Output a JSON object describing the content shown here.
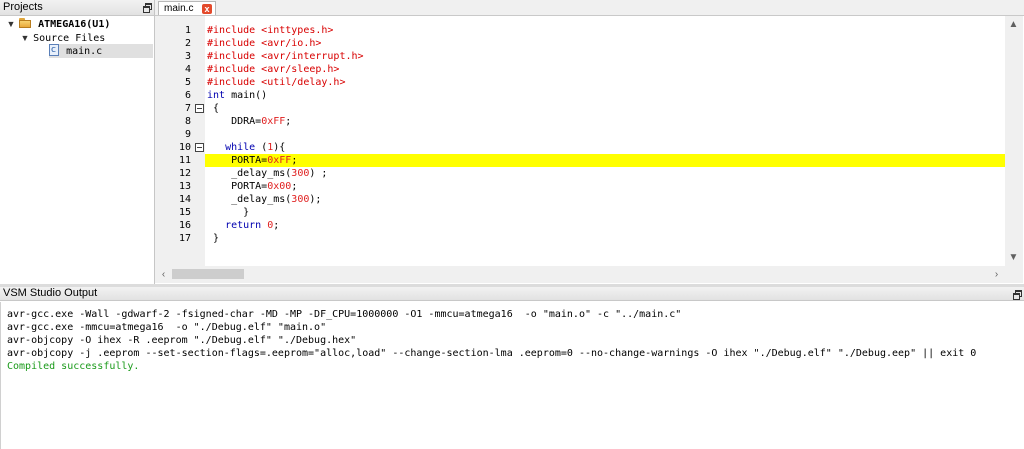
{
  "projects": {
    "title": "Projects",
    "project_name": "ATMEGA16(U1)",
    "source_files_label": "Source Files",
    "file_name": "main.c"
  },
  "editor": {
    "tab_label": "main.c",
    "close_glyph": "x",
    "line_numbers": [
      "1",
      "2",
      "3",
      "4",
      "5",
      "6",
      "7",
      "8",
      "9",
      "10",
      "11",
      "12",
      "13",
      "14",
      "15",
      "16",
      "17"
    ],
    "lines": [
      [
        {
          "t": "#include <inttypes.h>",
          "c": "pp"
        }
      ],
      [
        {
          "t": "#include <avr/io.h>",
          "c": "pp"
        }
      ],
      [
        {
          "t": "#include <avr/interrupt.h>",
          "c": "pp"
        }
      ],
      [
        {
          "t": "#include <avr/sleep.h>",
          "c": "pp"
        }
      ],
      [
        {
          "t": "#include <util/delay.h>",
          "c": "pp"
        }
      ],
      [
        {
          "t": "int",
          "c": "kw"
        },
        {
          "t": " main()",
          "c": "plain"
        }
      ],
      [
        {
          "t": " {",
          "c": "plain"
        }
      ],
      [
        {
          "t": "    DDRA=",
          "c": "plain"
        },
        {
          "t": "0xFF",
          "c": "num"
        },
        {
          "t": ";",
          "c": "plain"
        }
      ],
      [
        {
          "t": "",
          "c": "plain"
        }
      ],
      [
        {
          "t": "   ",
          "c": "plain"
        },
        {
          "t": "while",
          "c": "kw"
        },
        {
          "t": " (",
          "c": "plain"
        },
        {
          "t": "1",
          "c": "num"
        },
        {
          "t": "){",
          "c": "plain"
        }
      ],
      [
        {
          "t": "    PORTA=",
          "c": "plain"
        },
        {
          "t": "0xFF",
          "c": "num"
        },
        {
          "t": ";",
          "c": "plain"
        }
      ],
      [
        {
          "t": "    _delay_ms(",
          "c": "plain"
        },
        {
          "t": "300",
          "c": "num"
        },
        {
          "t": ") ;",
          "c": "plain"
        }
      ],
      [
        {
          "t": "    PORTA=",
          "c": "plain"
        },
        {
          "t": "0x00",
          "c": "num"
        },
        {
          "t": ";",
          "c": "plain"
        }
      ],
      [
        {
          "t": "    _delay_ms(",
          "c": "plain"
        },
        {
          "t": "300",
          "c": "num"
        },
        {
          "t": ");",
          "c": "plain"
        }
      ],
      [
        {
          "t": "      }",
          "c": "plain"
        }
      ],
      [
        {
          "t": "   ",
          "c": "plain"
        },
        {
          "t": "return",
          "c": "kw"
        },
        {
          "t": " ",
          "c": "plain"
        },
        {
          "t": "0",
          "c": "num"
        },
        {
          "t": ";",
          "c": "plain"
        }
      ],
      [
        {
          "t": " }",
          "c": "plain"
        }
      ]
    ],
    "highlighted_line": 11,
    "fold_lines": [
      7,
      10
    ]
  },
  "output": {
    "title": "VSM Studio Output",
    "lines": [
      "avr-gcc.exe -Wall -gdwarf-2 -fsigned-char -MD -MP -DF_CPU=1000000 -O1 -mmcu=atmega16  -o \"main.o\" -c \"../main.c\"",
      "avr-gcc.exe -mmcu=atmega16  -o \"./Debug.elf\" \"main.o\"",
      "avr-objcopy -O ihex -R .eeprom \"./Debug.elf\" \"./Debug.hex\"",
      "avr-objcopy -j .eeprom --set-section-flags=.eeprom=\"alloc,load\" --change-section-lma .eeprom=0 --no-change-warnings -O ihex \"./Debug.elf\" \"./Debug.eep\" || exit 0"
    ],
    "success": "Compiled successfully."
  },
  "colors": {
    "highlight": "#ffff00",
    "preprocessor": "#d80000",
    "keyword": "#0000b0",
    "number": "#e02020",
    "success": "#1a9a1a"
  }
}
